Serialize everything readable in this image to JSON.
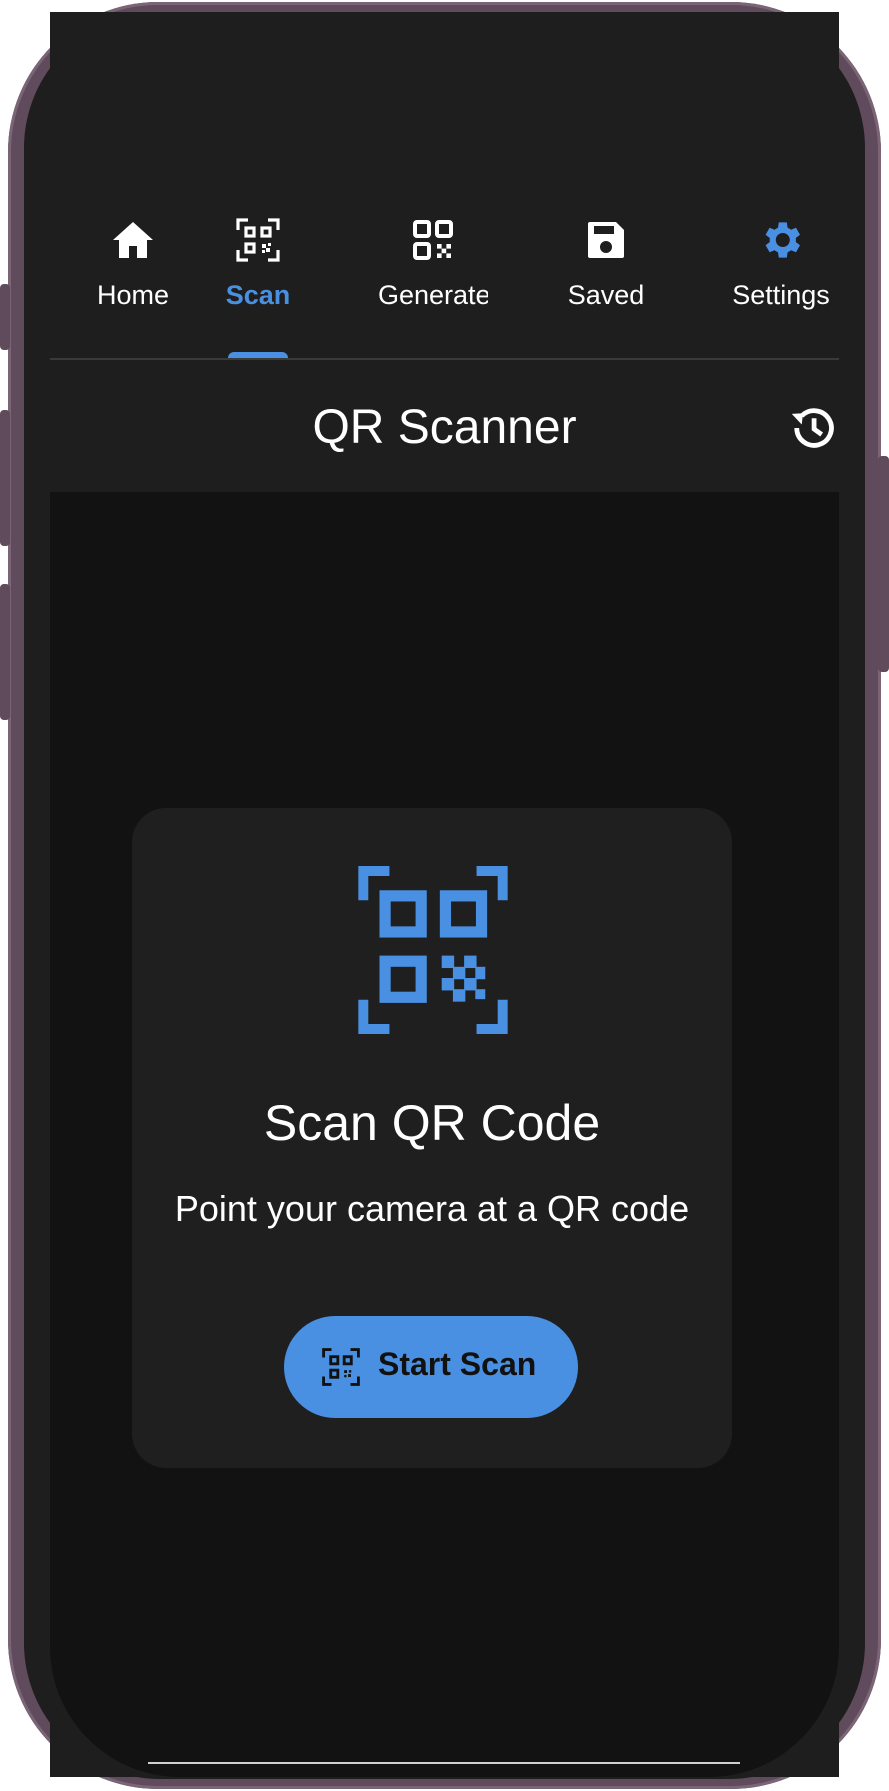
{
  "tabs": [
    {
      "label": "Home",
      "icon": "home-icon",
      "active": false
    },
    {
      "label": "Scan",
      "icon": "qr-scan-icon",
      "active": true
    },
    {
      "label": "Generate",
      "icon": "qr-code-icon",
      "active": false
    },
    {
      "label": "Saved",
      "icon": "save-icon",
      "active": false
    },
    {
      "label": "Settings",
      "icon": "gear-icon",
      "active": false
    }
  ],
  "appbar": {
    "title": "QR Scanner",
    "history_icon": "history-icon"
  },
  "card": {
    "icon": "qr-scan-icon",
    "title": "Scan QR Code",
    "subtitle": "Point your camera at a QR code",
    "button_label": "Start Scan",
    "button_icon": "qr-scan-icon"
  },
  "colors": {
    "accent": "#4a90e2",
    "background": "#121212",
    "surface": "#1f1f1f",
    "frame": "#5f4b5c"
  }
}
